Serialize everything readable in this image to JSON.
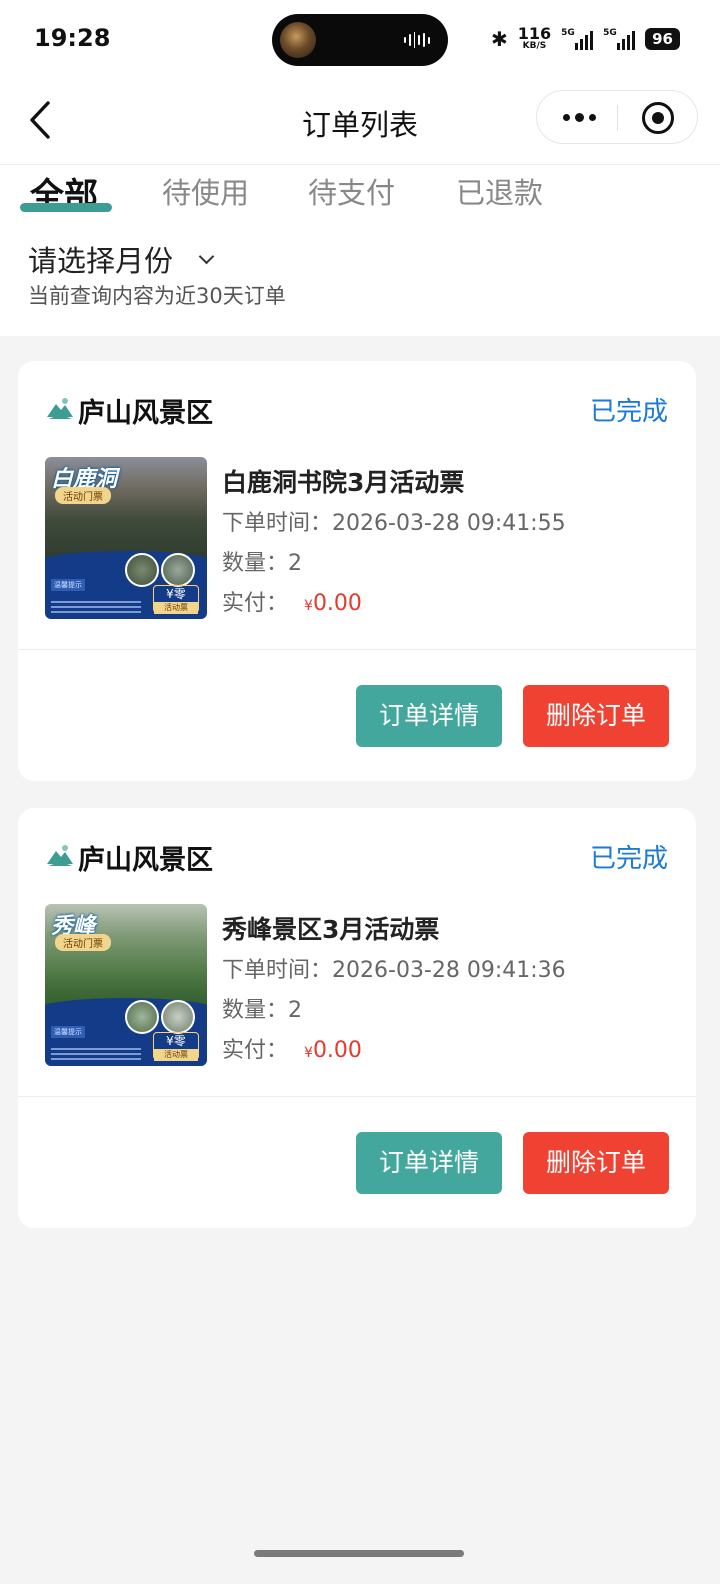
{
  "status_bar": {
    "time": "19:28",
    "net_speed": "116",
    "net_unit": "KB/S",
    "sig1_label": "5G",
    "sig2_label": "5G",
    "battery": "96"
  },
  "nav": {
    "title": "订单列表",
    "icons": [
      "back-icon",
      "more-icon",
      "target-icon"
    ]
  },
  "tabs": [
    {
      "label": "全部",
      "active": true
    },
    {
      "label": "待使用",
      "active": false
    },
    {
      "label": "待支付",
      "active": false
    },
    {
      "label": "已退款",
      "active": false
    }
  ],
  "filter": {
    "month_label": "请选择月份",
    "hint": "当前查询内容为近30天订单"
  },
  "accent_color": "#3d9d94",
  "orders": [
    {
      "scenic": "庐山风景区",
      "status": "已完成",
      "image_title": "白鹿洞",
      "image_tag": "活动门票",
      "image_price": "¥零",
      "image_price_sub": "活动票",
      "image_small_text": "温馨提示",
      "title": "白鹿洞书院3月活动票",
      "time_label": "下单时间：",
      "time": "2026-03-28 09:41:55",
      "qty_label": "数量：",
      "qty": "2",
      "paid_label": "实付：",
      "currency": "¥",
      "paid": "0.00",
      "detail_button": "订单详情",
      "delete_button": "删除订单"
    },
    {
      "scenic": "庐山风景区",
      "status": "已完成",
      "image_title": "秀峰",
      "image_tag": "活动门票",
      "image_price": "¥零",
      "image_price_sub": "活动票",
      "image_small_text": "温馨提示",
      "title": "秀峰景区3月活动票",
      "time_label": "下单时间：",
      "time": "2026-03-28 09:41:36",
      "qty_label": "数量：",
      "qty": "2",
      "paid_label": "实付：",
      "currency": "¥",
      "paid": "0.00",
      "detail_button": "订单详情",
      "delete_button": "删除订单"
    }
  ]
}
